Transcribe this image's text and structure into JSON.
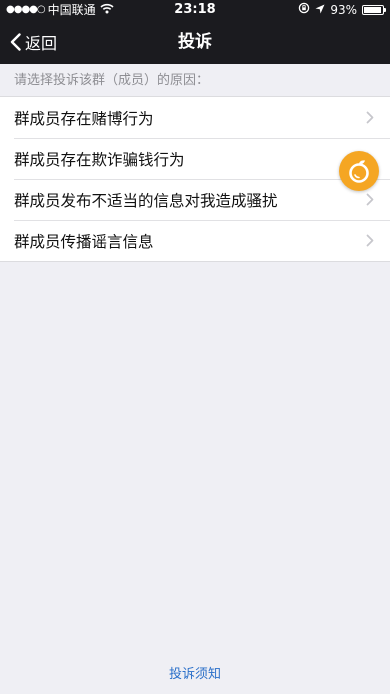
{
  "status_bar": {
    "signal_dots": "●●●●○",
    "carrier": "中国联通",
    "time": "23:18",
    "battery_text": "93%",
    "battery_level": 0.93,
    "icons": [
      "wifi-icon",
      "rotation-lock-icon",
      "location-arrow-icon",
      "battery-icon"
    ]
  },
  "nav": {
    "back_label": "返回",
    "title": "投诉"
  },
  "prompt": "请选择投诉该群（成员）的原因：",
  "reasons": [
    "群成员存在赌博行为",
    "群成员存在欺诈骗钱行为",
    "群成员发布不适当的信息对我造成骚扰",
    "群成员传播谣言信息"
  ],
  "floating_button": {
    "icon": "orange-fruit-icon",
    "color": "#f5a623"
  },
  "footer_link": "投诉须知",
  "colors": {
    "nav_background": "#1b1b1f",
    "page_background": "#efeff4",
    "link": "#2a6fc9"
  }
}
